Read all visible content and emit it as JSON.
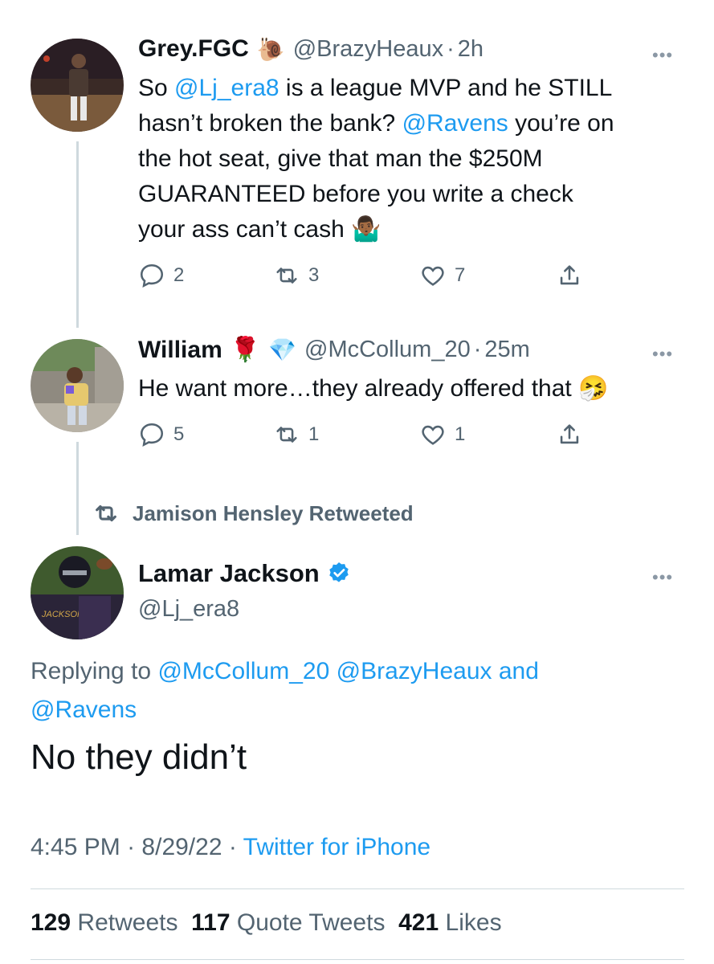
{
  "tweet1": {
    "name": "Grey.FGC",
    "emoji": "🐌",
    "handle": "@BrazyHeaux",
    "dot": "·",
    "time": "2h",
    "more": "•••",
    "line1_pre": "So ",
    "mention1": "@Lj_era8",
    "line1_post": " is a league MVP and he STILL",
    "line2_pre": "hasn’t broken the bank? ",
    "mention2": "@Ravens",
    "line2_post": " you’re on",
    "line3": "the hot seat, give that man the $250M",
    "line4": "GUARANTEED before you write a check",
    "line5": "your ass can’t cash",
    "line5_emoji": "🤷🏾‍♂️",
    "replies": "2",
    "retweets": "3",
    "likes": "7"
  },
  "tweet2": {
    "name": "William",
    "emoji1": "🌹",
    "emoji2": "💎",
    "handle": "@McCollum_20",
    "dot": "·",
    "time": "25m",
    "more": "•••",
    "text": "He want more…they already offered that",
    "text_emoji": "🤧",
    "replies": "5",
    "retweets": "1",
    "likes": "1"
  },
  "retweet_banner": "Jamison Hensley Retweeted",
  "main_tweet": {
    "name": "Lamar Jackson",
    "handle": "@Lj_era8",
    "more": "•••",
    "replying_label": "Replying to ",
    "reply_mention1": "@McCollum_20",
    "reply_mention2": "@BrazyHeaux",
    "reply_and": " and",
    "reply_mention3": "@Ravens",
    "text": "No they didn’t",
    "time": "4:45 PM",
    "sep": "·",
    "date": "8/29/22",
    "source": "Twitter for iPhone",
    "retweet_count": "129",
    "retweet_label": "Retweets",
    "quote_count": "117",
    "quote_label": "Quote Tweets",
    "like_count": "421",
    "like_label": "Likes"
  },
  "colors": {
    "accent": "#1d9bf0",
    "secondary_text": "#536471",
    "divider": "#cfd9de"
  }
}
